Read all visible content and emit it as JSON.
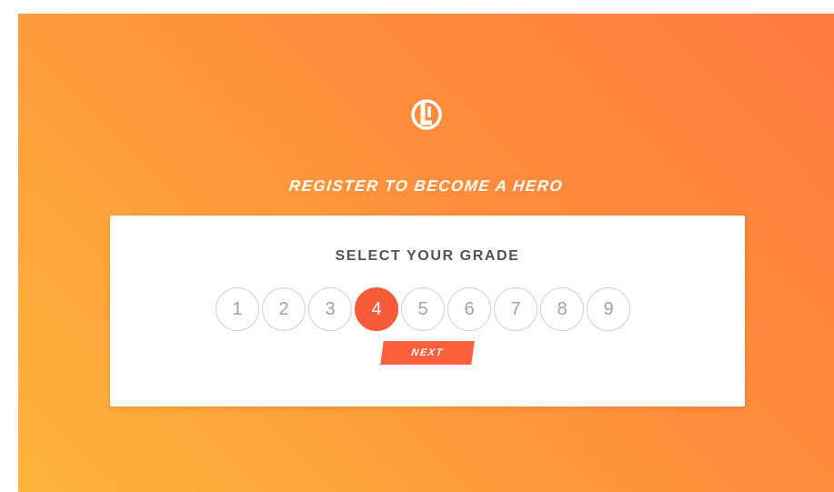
{
  "brand": {
    "logo_icon": "lightning-shield-logo-icon"
  },
  "headline": "REGISTER TO BECOME A HERO",
  "card": {
    "title": "SELECT YOUR GRADE",
    "grades": [
      "1",
      "2",
      "3",
      "4",
      "5",
      "6",
      "7",
      "8",
      "9"
    ],
    "selected_grade": "4",
    "next_label": "NEXT"
  },
  "colors": {
    "accent": "#f75b3a",
    "gradient_start": "#fdb43a",
    "gradient_end": "#ff7a3d",
    "card_title": "#4a5463",
    "grade_outline": "#c8d0da"
  }
}
